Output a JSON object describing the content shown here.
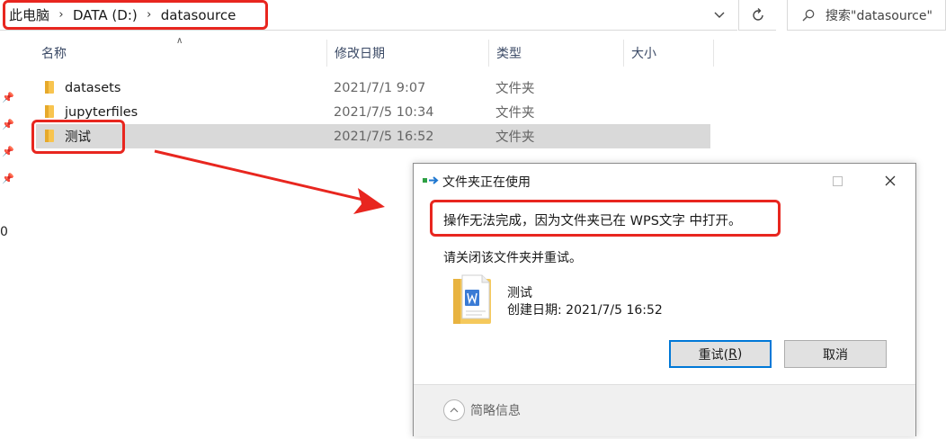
{
  "address": {
    "crumbs": [
      "此电脑",
      "DATA (D:)",
      "datasource"
    ]
  },
  "search": {
    "placeholder": "搜索\"datasource\""
  },
  "columns": {
    "name": "名称",
    "date": "修改日期",
    "type": "类型",
    "size": "大小"
  },
  "files": [
    {
      "name": "datasets",
      "date": "2021/7/1 9:07",
      "type": "文件夹"
    },
    {
      "name": "jupyterfiles",
      "date": "2021/7/5 10:34",
      "type": "文件夹"
    },
    {
      "name": "测试",
      "date": "2021/7/5 16:52",
      "type": "文件夹"
    }
  ],
  "left_stub": "0",
  "dialog": {
    "title": "文件夹正在使用",
    "message": "操作无法完成，因为文件夹已在 WPS文字 中打开。",
    "sub": "请关闭该文件夹并重试。",
    "file_name": "测试",
    "file_created": "创建日期: 2021/7/5 16:52",
    "retry_label": "重试(",
    "retry_key": "R",
    "retry_close": ")",
    "cancel_label": "取消",
    "details_label": "简略信息"
  },
  "colors": {
    "highlight": "#e8261f",
    "folder": "#f8c44f",
    "selected_row": "#d9d9d9"
  }
}
